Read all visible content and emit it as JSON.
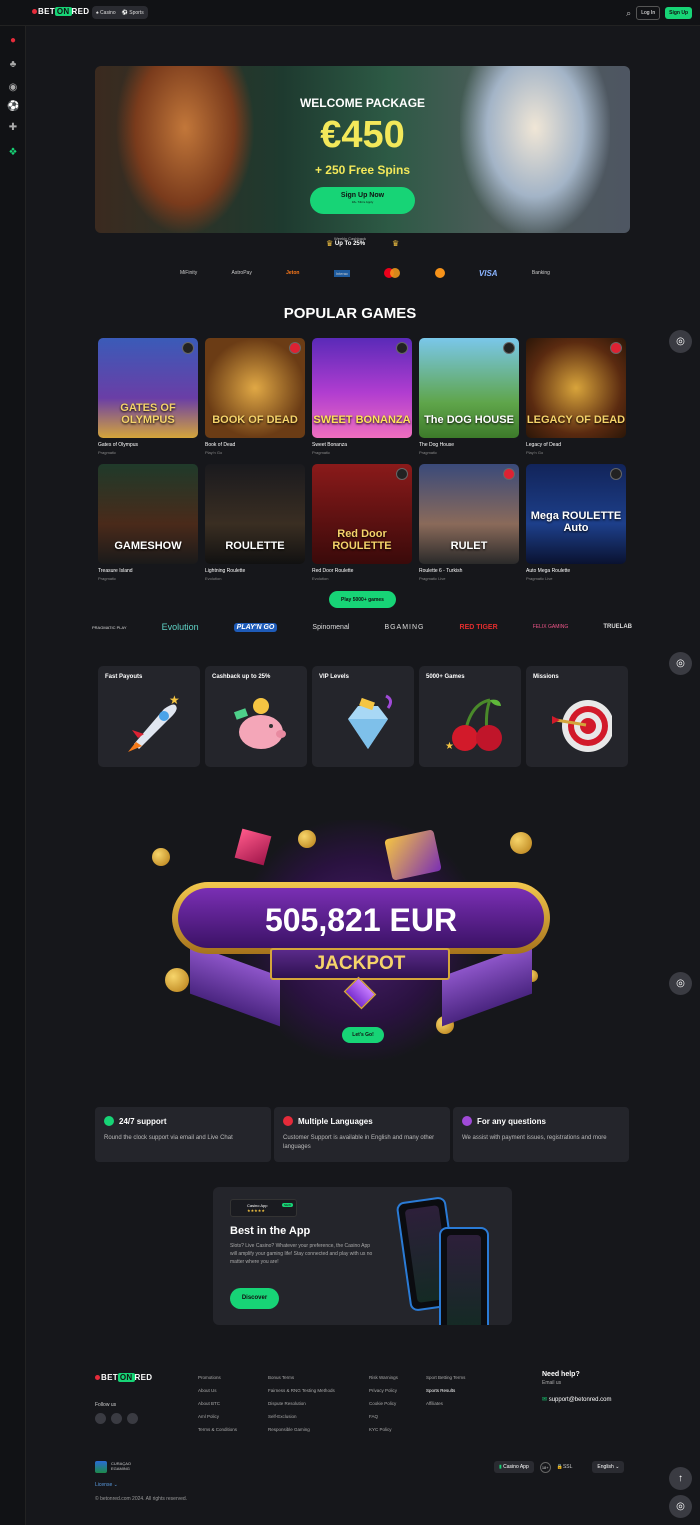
{
  "header": {
    "logo_bet": "BET",
    "logo_on": "ON",
    "logo_red": "RED",
    "modes": [
      "Casino",
      "Sports"
    ],
    "login": "Log In",
    "signup": "Sign Up"
  },
  "sidebar": {
    "icons": [
      "menu-icon",
      "fruit-icon",
      "cherry-icon",
      "live-icon",
      "soccer-icon",
      "gamepad-icon",
      "gift-icon"
    ]
  },
  "hero": {
    "title": "WELCOME PACKAGE",
    "amount": "€450",
    "spins": "+ 250 Free Spins",
    "cta": "Sign Up Now",
    "cta_sub": "18+ T&Cs Apply",
    "cashback_label": "Weekly Cashback",
    "cashback_value": "Up To 25%"
  },
  "payments": [
    "MiFinity",
    "AstroPay",
    "Jeton",
    "Interac",
    "Mastercard",
    "Bitcoin",
    "VISA",
    "Banking"
  ],
  "popular": {
    "title": "POPULAR GAMES",
    "games": [
      {
        "name": "Gates of Olympus",
        "provider": "Pragmatic",
        "art": "GATES OF OLYMPUS"
      },
      {
        "name": "Book of Dead",
        "provider": "Play'n Go",
        "art": "BOOK OF DEAD"
      },
      {
        "name": "Sweet Bonanza",
        "provider": "Pragmatic",
        "art": "SWEET BONANZA"
      },
      {
        "name": "The Dog House",
        "provider": "Pragmatic",
        "art": "The DOG HOUSE"
      },
      {
        "name": "Legacy of Dead",
        "provider": "Play'n Go",
        "art": "LEGACY OF DEAD"
      },
      {
        "name": "Treasure Island",
        "provider": "Pragmatic",
        "art": "GAMESHOW"
      },
      {
        "name": "Lightning Roulette",
        "provider": "Evolution",
        "art": "ROULETTE"
      },
      {
        "name": "Red Door Roulette",
        "provider": "Evolution",
        "art": "Red Door ROULETTE"
      },
      {
        "name": "Roulette 6 - Turkish",
        "provider": "Pragmatic Live",
        "art": "RULET"
      },
      {
        "name": "Auto Mega Roulette",
        "provider": "Pragmatic Live",
        "art": "Mega ROULETTE Auto"
      }
    ],
    "play_all": "Play 5000+ games"
  },
  "providers": [
    "PRAGMATIC PLAY",
    "Evolution",
    "PLAY'N GO",
    "Spinomenal",
    "BGAMING",
    "RED TIGER",
    "FELIX GAMING",
    "TRUELAB"
  ],
  "features": [
    "Fast Payouts",
    "Cashback up to 25%",
    "VIP Levels",
    "5000+ Games",
    "Missions"
  ],
  "jackpot": {
    "amount": "505,821 EUR",
    "label": "JACKPOT",
    "cta": "Let's Go!"
  },
  "support": [
    {
      "title": "24/7 support",
      "desc": "Round the clock support via email and Live Chat",
      "color": "#17d476"
    },
    {
      "title": "Multiple Languages",
      "desc": "Customer Support is available in English and many other languages",
      "color": "#e52b3a"
    },
    {
      "title": "For any questions",
      "desc": "We assist with payment issues, registrations and more",
      "color": "#a04ad8"
    }
  ],
  "app": {
    "chip_title": "Casino App",
    "chip_stars": "★★★★★",
    "chip_new": "NEW",
    "title": "Best in the App",
    "desc": "Slots? Live Casino? Whatever your preference, the Casino App will amplify your gaming life! Stay connected and play with us no matter where you are!",
    "cta": "Discover"
  },
  "footer": {
    "follow": "Follow us",
    "col1": [
      "Promotions",
      "About Us",
      "About BTC",
      "Aml Policy",
      "Terms & Conditions"
    ],
    "col2": [
      "Bonus Terms",
      "Fairness & RNG Testing Methods",
      "Dispute Resolution",
      "Self-Exclusion",
      "Responsible Gaming"
    ],
    "col3": [
      "Risk Warnings",
      "Privacy Policy",
      "Cookie Policy",
      "FAQ",
      "KYC Policy"
    ],
    "col4": [
      "Sport Betting Terms",
      "Sports Results",
      "Affiliates"
    ],
    "help_title": "Need help?",
    "help_email_label": "Email us",
    "help_email": "support@betonred.com",
    "curacao": "CURAÇAO EGAMING",
    "license": "License",
    "copyright": "© betonred.com 2024. All rights reserved.",
    "casino_app": "Casino App",
    "age": "18+",
    "ssl": "SSL",
    "language": "English"
  },
  "colors": {
    "accent": "#17d476",
    "brand_red": "#e52b3a",
    "bg": "#16171b",
    "card": "#24252b"
  }
}
